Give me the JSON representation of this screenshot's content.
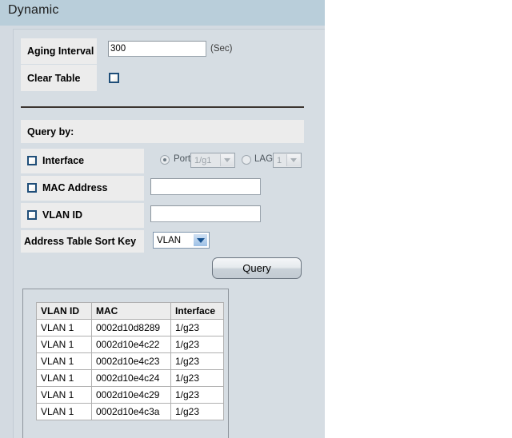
{
  "page": {
    "title": "Dynamic"
  },
  "settings": {
    "aging_label": "Aging Interval",
    "aging_value": "300",
    "aging_unit": "(Sec)",
    "clear_label": "Clear Table",
    "clear_checked": false
  },
  "query": {
    "section_title": "Query by:",
    "interface": {
      "label": "Interface",
      "checked": false,
      "port_radio_label": "Port",
      "port_radio_selected": true,
      "port_value": "1/g1",
      "lag_radio_label": "LAG",
      "lag_radio_selected": false,
      "lag_value": "1"
    },
    "mac_address": {
      "label": "MAC Address",
      "checked": false,
      "value": ""
    },
    "vlan_id": {
      "label": "VLAN ID",
      "checked": false,
      "value": ""
    },
    "sort_key": {
      "label": "Address Table Sort Key",
      "value": "VLAN"
    },
    "query_button": "Query"
  },
  "results": {
    "columns": [
      "VLAN ID",
      "MAC",
      "Interface"
    ],
    "rows": [
      [
        "VLAN 1",
        "0002d10d8289",
        "1/g23"
      ],
      [
        "VLAN 1",
        "0002d10e4c22",
        "1/g23"
      ],
      [
        "VLAN 1",
        "0002d10e4c23",
        "1/g23"
      ],
      [
        "VLAN 1",
        "0002d10e4c24",
        "1/g23"
      ],
      [
        "VLAN 1",
        "0002d10e4c29",
        "1/g23"
      ],
      [
        "VLAN 1",
        "0002d10e4c3a",
        "1/g23"
      ]
    ]
  },
  "colors": {
    "header_band": "#b9ceda",
    "panel_bg": "#d3dae1",
    "inner_bg": "#d6dde3",
    "label_cell": "#ececec",
    "checkbox_border": "#1f4e79",
    "select_arrow": "#16518f"
  }
}
